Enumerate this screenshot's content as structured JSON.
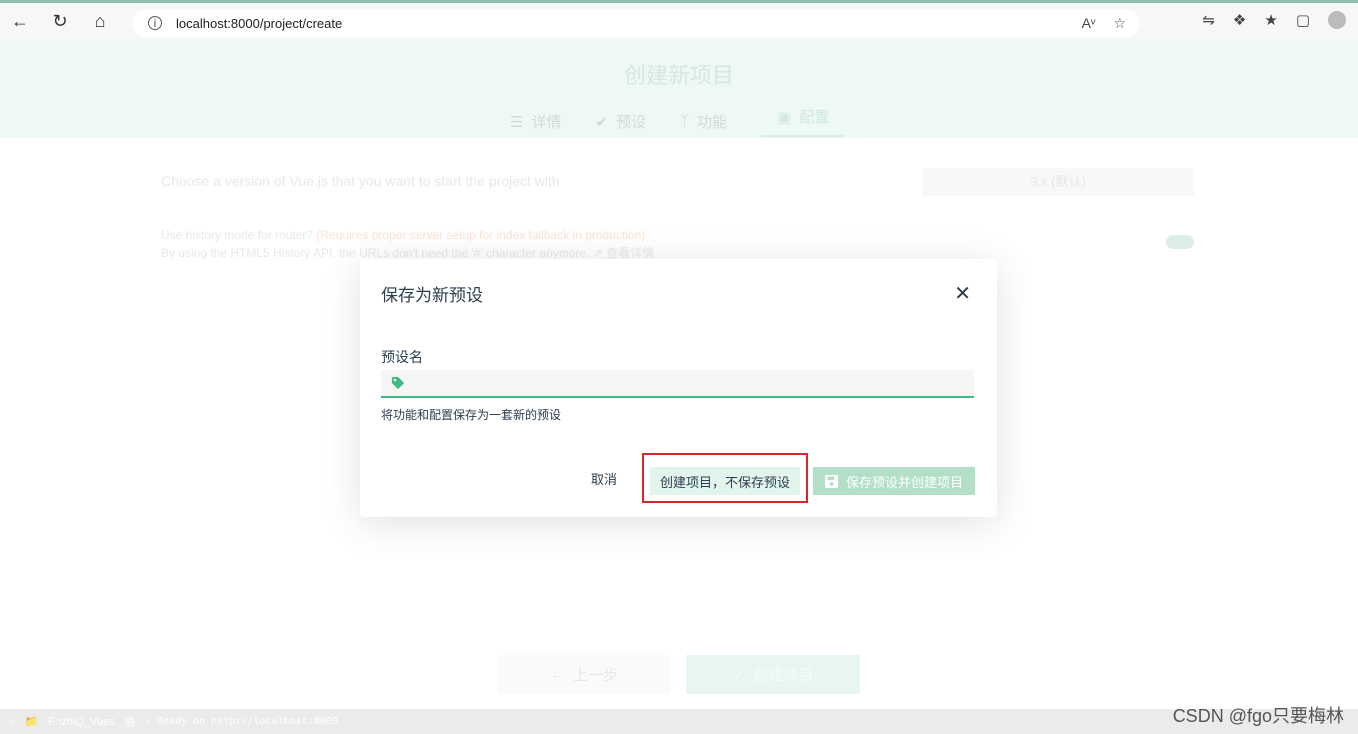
{
  "browser": {
    "url": "localhost:8000/project/create",
    "info_icon": "info-icon"
  },
  "page": {
    "title": "创建新项目",
    "steps": [
      {
        "label": "详情",
        "icon": "list-icon"
      },
      {
        "label": "预设",
        "icon": "check-circle-icon"
      },
      {
        "label": "功能",
        "icon": "fork-icon"
      },
      {
        "label": "配置",
        "icon": "config-icon"
      }
    ],
    "prompt_version": "Choose a version of Vue.js that you want to start the project with",
    "version_value": "3.x (默认)",
    "prompt_history_q": "Use history mode for router?",
    "prompt_history_warn": "(Requires proper server setup for index fallback in production)",
    "prompt_history_desc": "By using the HTML5 History API, the URLs don't need the '#' character anymore.",
    "more_info": "查看详情",
    "prev_label": "上一步",
    "create_label": "创建项目"
  },
  "statusbar": {
    "folder": "F:\\zhiQ_Vues",
    "log": "✓ Ready on http://localhost:8000"
  },
  "modal": {
    "title": "保存为新预设",
    "field_label": "预设名",
    "input_value": "",
    "hint": "将功能和配置保存为一套新的预设",
    "cancel_label": "取消",
    "no_save_label": "创建项目，不保存预设",
    "save_create_label": "保存预设并创建项目"
  },
  "watermark": "CSDN @fgo只要梅林",
  "colors": {
    "accent": "#42b983",
    "highlight_border": "#d9262a"
  }
}
